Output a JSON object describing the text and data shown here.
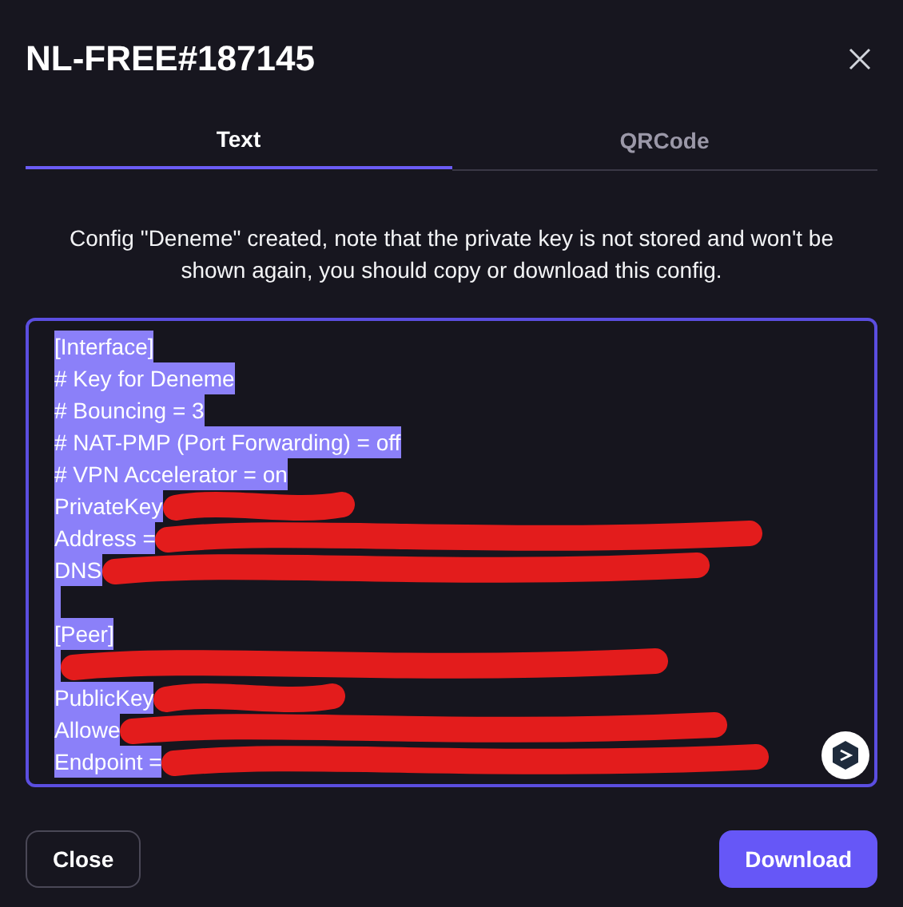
{
  "dialog": {
    "title": "NL-FREE#187145"
  },
  "tabs": [
    {
      "label": "Text",
      "selected": true
    },
    {
      "label": "QRCode",
      "selected": false
    }
  ],
  "message": "Config \"Deneme\" created, note that the private key is not stored and won't be shown again, you should copy or download this config.",
  "config": {
    "selected": true,
    "lines": [
      {
        "text": "[Interface]",
        "redacted": false
      },
      {
        "text": "# Key for Deneme",
        "redacted": false
      },
      {
        "text": "# Bouncing = 3",
        "redacted": false
      },
      {
        "text": "# NAT-PMP (Port Forwarding) = off",
        "redacted": false
      },
      {
        "text": "# VPN Accelerator = on",
        "redacted": false
      },
      {
        "text": "PrivateKey",
        "redacted": true
      },
      {
        "text": "Address =",
        "redacted": true
      },
      {
        "text": "DNS",
        "redacted": true
      },
      {
        "redacted": false
      },
      {
        "text": "[Peer]",
        "redacted": false
      },
      {
        "redacted": true
      },
      {
        "text": "PublicKey",
        "redacted": true
      },
      {
        "text": "Allowe",
        "redacted": true
      },
      {
        "text": "Endpoint =",
        "redacted": true
      }
    ]
  },
  "buttons": [
    {
      "label": "Close",
      "kind": "secondary"
    },
    {
      "label": "Download",
      "kind": "primary"
    }
  ]
}
